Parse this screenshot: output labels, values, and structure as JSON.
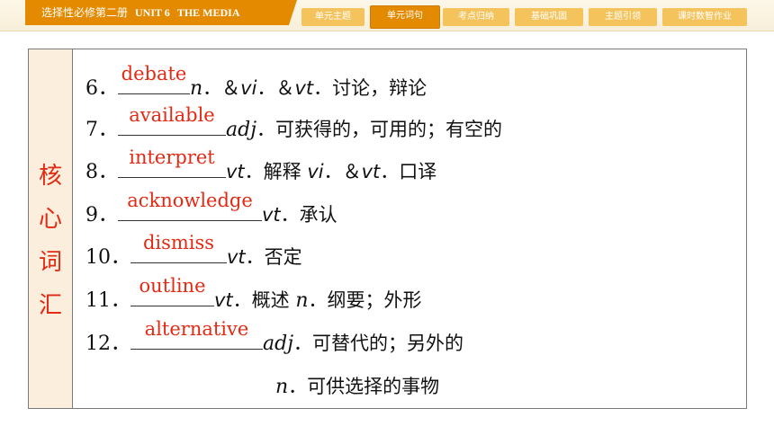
{
  "header": {
    "title_cn": "选择性必修第二册",
    "title_unit": "UNIT 6",
    "title_topic": "THE MEDIA",
    "tabs": [
      {
        "label": "单元主题"
      },
      {
        "label": "单元词句"
      },
      {
        "label": "考点归纳"
      },
      {
        "label": "基础巩固"
      },
      {
        "label": "主题引领"
      },
      {
        "label": "课时数智作业"
      }
    ],
    "active_tab": "单元词句",
    "accent": "#e48a00",
    "tab_color": "#f5c35c"
  },
  "section": {
    "chars": [
      "核",
      "心",
      "词",
      "汇"
    ],
    "color": "#e22a14"
  },
  "vocab": [
    {
      "num": "6．",
      "answer": "debate",
      "def": [
        {
          "t": "n",
          "c": "pos"
        },
        {
          "t": "．＆",
          "c": "cn"
        },
        {
          "t": "vi",
          "c": "vt"
        },
        {
          "t": "．＆",
          "c": "cn"
        },
        {
          "t": "vt",
          "c": "vt"
        },
        {
          "t": "．讨论，辩论",
          "c": "cn"
        }
      ]
    },
    {
      "num": "7．",
      "answer": "available",
      "def": [
        {
          "t": "adj",
          "c": "pos"
        },
        {
          "t": "．可获得的，可用的；有空的",
          "c": "cn"
        }
      ]
    },
    {
      "num": "8．",
      "answer": "interpret",
      "def": [
        {
          "t": "vt",
          "c": "vt"
        },
        {
          "t": "．解释 ",
          "c": "cn"
        },
        {
          "t": "vi",
          "c": "vt"
        },
        {
          "t": "．＆",
          "c": "cn"
        },
        {
          "t": "vt",
          "c": "vt"
        },
        {
          "t": "．口译",
          "c": "cn"
        }
      ]
    },
    {
      "num": "9．",
      "answer": "acknowledge",
      "def": [
        {
          "t": "vt",
          "c": "vt"
        },
        {
          "t": "．承认",
          "c": "cn"
        }
      ]
    },
    {
      "num": "10．",
      "answer": "dismiss",
      "def": [
        {
          "t": "vt",
          "c": "vt"
        },
        {
          "t": "．否定",
          "c": "cn"
        }
      ]
    },
    {
      "num": "11．",
      "answer": "outline",
      "def": [
        {
          "t": "vt",
          "c": "vt"
        },
        {
          "t": "．概述 ",
          "c": "cn"
        },
        {
          "t": "n",
          "c": "pos"
        },
        {
          "t": "．纲要；外形",
          "c": "cn"
        }
      ]
    },
    {
      "num": "12．",
      "answer": "alternative",
      "def": [
        {
          "t": "adj",
          "c": "pos"
        },
        {
          "t": "．可替代的；另外的",
          "c": "cn"
        }
      ]
    }
  ],
  "vocab_extra": [
    {
      "t": "n",
      "c": "pos"
    },
    {
      "t": "．可供选择的事物",
      "c": "cn"
    }
  ]
}
